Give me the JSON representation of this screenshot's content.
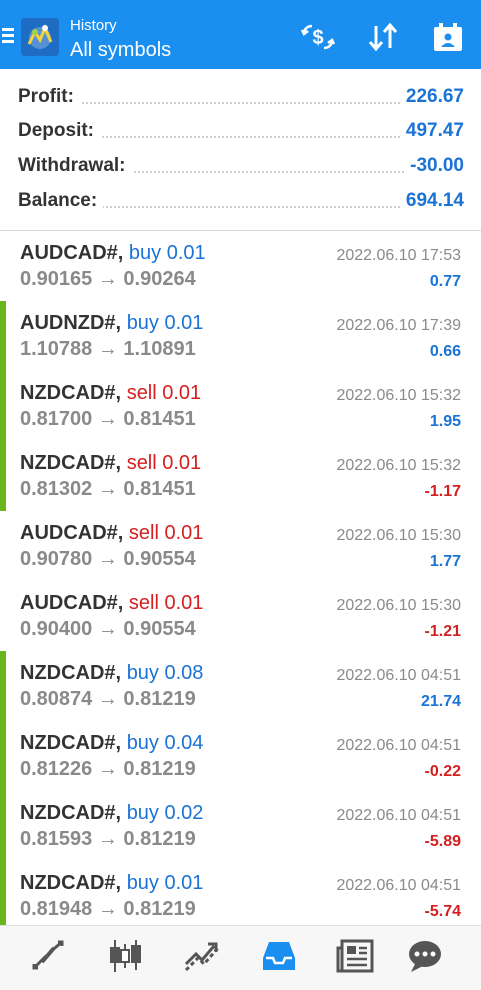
{
  "header": {
    "subtitle": "History",
    "title": "All symbols",
    "colors": {
      "bar": "#1a8ff0"
    },
    "icons": [
      "menu-icon",
      "app-logo-icon",
      "currency-exchange-icon",
      "sort-icon",
      "calendar-icon"
    ]
  },
  "summary": [
    {
      "label": "Profit:",
      "value": "226.67"
    },
    {
      "label": "Deposit:",
      "value": "497.47"
    },
    {
      "label": "Withdrawal:",
      "value": "-30.00"
    },
    {
      "label": "Balance:",
      "value": "694.14"
    }
  ],
  "trades": [
    {
      "symbol": "AUDCAD#,",
      "action": "buy 0.01",
      "side": "buy",
      "prices": "0.90165 → 0.90264",
      "time": "2022.06.10 17:53",
      "profit": "0.77",
      "profit_sign": "pos",
      "marked": false
    },
    {
      "symbol": "AUDNZD#,",
      "action": "buy 0.01",
      "side": "buy",
      "prices": "1.10788 → 1.10891",
      "time": "2022.06.10 17:39",
      "profit": "0.66",
      "profit_sign": "pos",
      "marked": true
    },
    {
      "symbol": "NZDCAD#,",
      "action": "sell 0.01",
      "side": "sell",
      "prices": "0.81700 → 0.81451",
      "time": "2022.06.10 15:32",
      "profit": "1.95",
      "profit_sign": "pos",
      "marked": true
    },
    {
      "symbol": "NZDCAD#,",
      "action": "sell 0.01",
      "side": "sell",
      "prices": "0.81302 → 0.81451",
      "time": "2022.06.10 15:32",
      "profit": "-1.17",
      "profit_sign": "neg",
      "marked": true
    },
    {
      "symbol": "AUDCAD#,",
      "action": "sell 0.01",
      "side": "sell",
      "prices": "0.90780 → 0.90554",
      "time": "2022.06.10 15:30",
      "profit": "1.77",
      "profit_sign": "pos",
      "marked": false
    },
    {
      "symbol": "AUDCAD#,",
      "action": "sell 0.01",
      "side": "sell",
      "prices": "0.90400 → 0.90554",
      "time": "2022.06.10 15:30",
      "profit": "-1.21",
      "profit_sign": "neg",
      "marked": false
    },
    {
      "symbol": "NZDCAD#,",
      "action": "buy 0.08",
      "side": "buy",
      "prices": "0.80874 → 0.81219",
      "time": "2022.06.10 04:51",
      "profit": "21.74",
      "profit_sign": "pos",
      "marked": true
    },
    {
      "symbol": "NZDCAD#,",
      "action": "buy 0.04",
      "side": "buy",
      "prices": "0.81226 → 0.81219",
      "time": "2022.06.10 04:51",
      "profit": "-0.22",
      "profit_sign": "neg",
      "marked": true
    },
    {
      "symbol": "NZDCAD#,",
      "action": "buy 0.02",
      "side": "buy",
      "prices": "0.81593 → 0.81219",
      "time": "2022.06.10 04:51",
      "profit": "-5.89",
      "profit_sign": "neg",
      "marked": true
    },
    {
      "symbol": "NZDCAD#,",
      "action": "buy 0.01",
      "side": "buy",
      "prices": "0.81948 → 0.81219",
      "time": "2022.06.10 04:51",
      "profit": "-5.74",
      "profit_sign": "neg",
      "marked": true
    }
  ],
  "bottom_nav": {
    "items": [
      "quotes-icon",
      "chart-icon",
      "trade-icon",
      "history-icon",
      "news-icon",
      "chat-icon"
    ],
    "active": "history-icon",
    "active_color": "#1a8ff0",
    "inactive_color": "#555555"
  },
  "colors": {
    "buy": "#1a73d6",
    "sell": "#d42020",
    "profit_pos": "#1a73d6",
    "profit_neg": "#d42020",
    "marker": "#6ab41d"
  }
}
